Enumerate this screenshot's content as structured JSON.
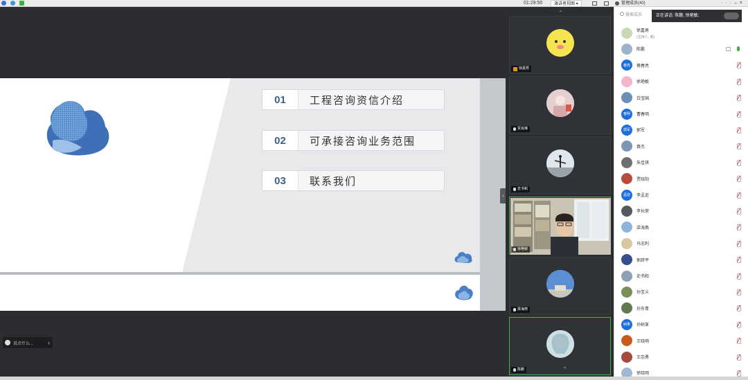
{
  "topbar": {
    "time": "01:29:50",
    "view_mode": "演讲者视图",
    "member_header": "管理成员(40)"
  },
  "slide": {
    "items": [
      {
        "num": "01",
        "text": "工程咨询资信介绍"
      },
      {
        "num": "02",
        "text": "可承接咨询业务范围"
      },
      {
        "num": "03",
        "text": "联系我们"
      }
    ]
  },
  "chat": {
    "placeholder": "说点什么..."
  },
  "videos": [
    {
      "name": "徐嘉男",
      "host": true
    },
    {
      "name": "贾肖琳",
      "host": false
    },
    {
      "name": "史书和",
      "host": false
    },
    {
      "name": "徐艳敏",
      "host": false
    },
    {
      "name": "梁海燕",
      "host": false
    },
    {
      "name": "陈鹏",
      "host": false
    }
  ],
  "members_panel": {
    "search_placeholder": "搜索成员",
    "speaking": "正在讲话: 陈鹏; 徐艳敏;",
    "host_sub": "(主持人, 我)",
    "list": [
      {
        "name": "徐嘉男",
        "mic": "none",
        "color": "#c9d9b0",
        "badge": ""
      },
      {
        "name": "陈鹏",
        "mic": "on",
        "color": "#9db3c7",
        "badge": ""
      },
      {
        "name": "蔡春亮",
        "mic": "muted",
        "color": "#1e6fd9",
        "badge": "春亮"
      },
      {
        "name": "徐艳敏",
        "mic": "muted",
        "color": "#f4b6c8",
        "badge": ""
      },
      {
        "name": "白宝国",
        "mic": "muted",
        "color": "#6b8fb5",
        "badge": ""
      },
      {
        "name": "曹春明",
        "mic": "muted",
        "color": "#1e6fd9",
        "badge": "春明"
      },
      {
        "name": "郭军",
        "mic": "muted",
        "color": "#1e6fd9",
        "badge": "郭军"
      },
      {
        "name": "蓑杰",
        "mic": "muted",
        "color": "#7d97b2",
        "badge": ""
      },
      {
        "name": "朱佳琪",
        "mic": "muted",
        "color": "#6d6f73",
        "badge": ""
      },
      {
        "name": "贾晓阳",
        "mic": "muted",
        "color": "#b74b3c",
        "badge": ""
      },
      {
        "name": "李孟迩",
        "mic": "muted",
        "color": "#1e6fd9",
        "badge": "孟迩"
      },
      {
        "name": "李长荣",
        "mic": "muted",
        "color": "#555a60",
        "badge": ""
      },
      {
        "name": "梁海燕",
        "mic": "muted",
        "color": "#8fb3d9",
        "badge": ""
      },
      {
        "name": "马忠利",
        "mic": "muted",
        "color": "#d9c7a3",
        "badge": ""
      },
      {
        "name": "郭跻平",
        "mic": "muted",
        "color": "#3a4d8f",
        "badge": ""
      },
      {
        "name": "史书和",
        "mic": "muted",
        "color": "#8ea0b3",
        "badge": ""
      },
      {
        "name": "孙宝义",
        "mic": "muted",
        "color": "#7a8f5a",
        "badge": ""
      },
      {
        "name": "孙东青",
        "mic": "muted",
        "color": "#5f7a4e",
        "badge": ""
      },
      {
        "name": "孙树革",
        "mic": "muted",
        "color": "#1e6fd9",
        "badge": "树革"
      },
      {
        "name": "王晓明",
        "mic": "muted",
        "color": "#c85a1e",
        "badge": ""
      },
      {
        "name": "王志勇",
        "mic": "muted",
        "color": "#a64a3a",
        "badge": ""
      },
      {
        "name": "徐晓明",
        "mic": "muted",
        "color": "#9fbad0",
        "badge": ""
      }
    ]
  }
}
